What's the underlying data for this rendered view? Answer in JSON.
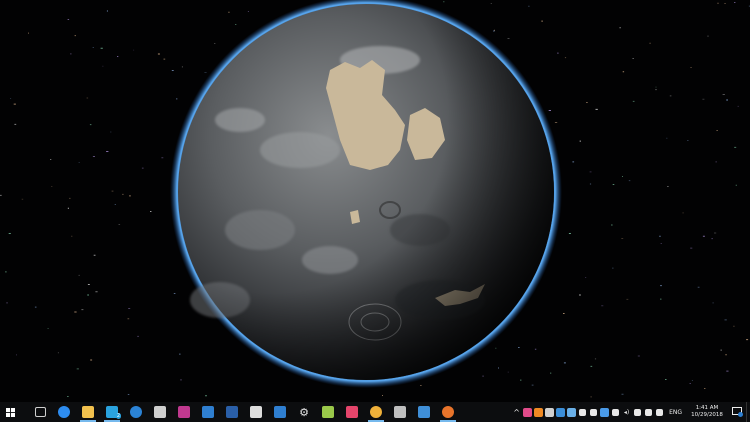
{
  "taskbar": {
    "start_icon": "windows-logo-icon",
    "apps": [
      {
        "icon": "task-view-icon",
        "color": "#cfcfcf",
        "running": false
      },
      {
        "icon": "chat-bubble-icon",
        "color": "#2d8cf0",
        "running": false
      },
      {
        "icon": "file-explorer-icon",
        "color": "#f2c14e",
        "running": true
      },
      {
        "icon": "telegram-icon",
        "color": "#2aa3df",
        "running": true,
        "badge": "2"
      },
      {
        "icon": "info-app-icon",
        "color": "#2b83d6",
        "running": false
      },
      {
        "icon": "steam-box-icon",
        "color": "#cfcfcf",
        "running": false
      },
      {
        "icon": "paint-app-icon",
        "color": "#c0398f",
        "running": false
      },
      {
        "icon": "visual-studio-code-icon",
        "color": "#2f7fd1",
        "running": false
      },
      {
        "icon": "powershell-icon",
        "color": "#2a5fa8",
        "running": false
      },
      {
        "icon": "puzzle-app-icon",
        "color": "#dddddd",
        "running": false
      },
      {
        "icon": "checkmark-app-icon",
        "color": "#2f7fd1",
        "running": false
      },
      {
        "icon": "settings-gear-icon",
        "color": "#e6e6e6",
        "running": false
      },
      {
        "icon": "tree-app-icon",
        "color": "#9ac84a",
        "running": false
      },
      {
        "icon": "instagram-icon",
        "color": "#e5456b",
        "running": false
      },
      {
        "icon": "chrome-icon",
        "color": "#f0b13a",
        "running": true
      },
      {
        "icon": "printer-icon",
        "color": "#bfbfbf",
        "running": false
      },
      {
        "icon": "screen-app-icon",
        "color": "#3f8fd8",
        "running": false
      },
      {
        "icon": "firefox-icon",
        "color": "#e8742b",
        "running": true
      }
    ],
    "tray": [
      {
        "icon": "chevron-up-icon",
        "color": "#e8e8e8"
      },
      {
        "icon": "colorful-app-icon",
        "color": "#e14b8a"
      },
      {
        "icon": "orange-app-icon",
        "color": "#f08a24"
      },
      {
        "icon": "arrow-app-icon",
        "color": "#d0d0d0"
      },
      {
        "icon": "wifi-app-icon",
        "color": "#3b8ed8"
      },
      {
        "icon": "monitor-app-icon",
        "color": "#6ab0e8"
      },
      {
        "icon": "bitcoin-icon",
        "color": "#e8e8e8"
      },
      {
        "icon": "cloud-icon",
        "color": "#e8e8e8"
      },
      {
        "icon": "dropbox-icon",
        "color": "#4a9ae8"
      },
      {
        "icon": "usb-icon",
        "color": "#e8e8e8"
      },
      {
        "icon": "volume-icon",
        "color": "#e8e8e8"
      },
      {
        "icon": "network-icon",
        "color": "#e8e8e8"
      },
      {
        "icon": "pen-icon",
        "color": "#e8e8e8"
      },
      {
        "icon": "touch-keyboard-icon",
        "color": "#e8e8e8"
      }
    ],
    "language": "ENG",
    "time": "1:41 AM",
    "date": "10/29/2018",
    "notifications_badge": "3"
  }
}
